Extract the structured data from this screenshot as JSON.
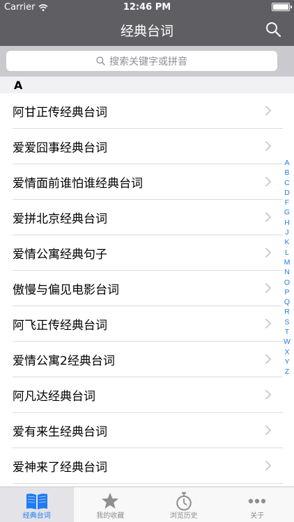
{
  "status_bar": {
    "carrier": "Carrier",
    "time": "12:46 PM"
  },
  "nav": {
    "title": "经典台词",
    "search_icon": "search-icon"
  },
  "search": {
    "placeholder": "搜索关键字或拼音"
  },
  "section": {
    "header": "A"
  },
  "list": {
    "items": [
      {
        "label": "阿甘正传经典台词"
      },
      {
        "label": "爱爱囧事经典台词"
      },
      {
        "label": "爱情面前谁怕谁经典台词"
      },
      {
        "label": "爱拼北京经典台词"
      },
      {
        "label": "爱情公寓经典句子"
      },
      {
        "label": "傲慢与偏见电影台词"
      },
      {
        "label": "阿飞正传经典台词"
      },
      {
        "label": "爱情公寓2经典台词"
      },
      {
        "label": "阿凡达经典台词"
      },
      {
        "label": "爱有来生经典台词"
      },
      {
        "label": "爱神来了经典台词"
      }
    ]
  },
  "index": [
    "A",
    "B",
    "C",
    "D",
    "F",
    "G",
    "H",
    "J",
    "K",
    "L",
    "M",
    "N",
    "O",
    "P",
    "Q",
    "R",
    "S",
    "T",
    "W",
    "X",
    "Y",
    "Z"
  ],
  "tabs": [
    {
      "label": "经典台词",
      "icon": "book-icon",
      "active": true
    },
    {
      "label": "我的收藏",
      "icon": "star-icon",
      "active": false
    },
    {
      "label": "浏览历史",
      "icon": "stopwatch-icon",
      "active": false
    },
    {
      "label": "关于",
      "icon": "more-icon",
      "active": false
    }
  ],
  "colors": {
    "nav_bg": "#5f5f63",
    "accent": "#1e7cf2",
    "search_bg": "#c9c9ce"
  }
}
